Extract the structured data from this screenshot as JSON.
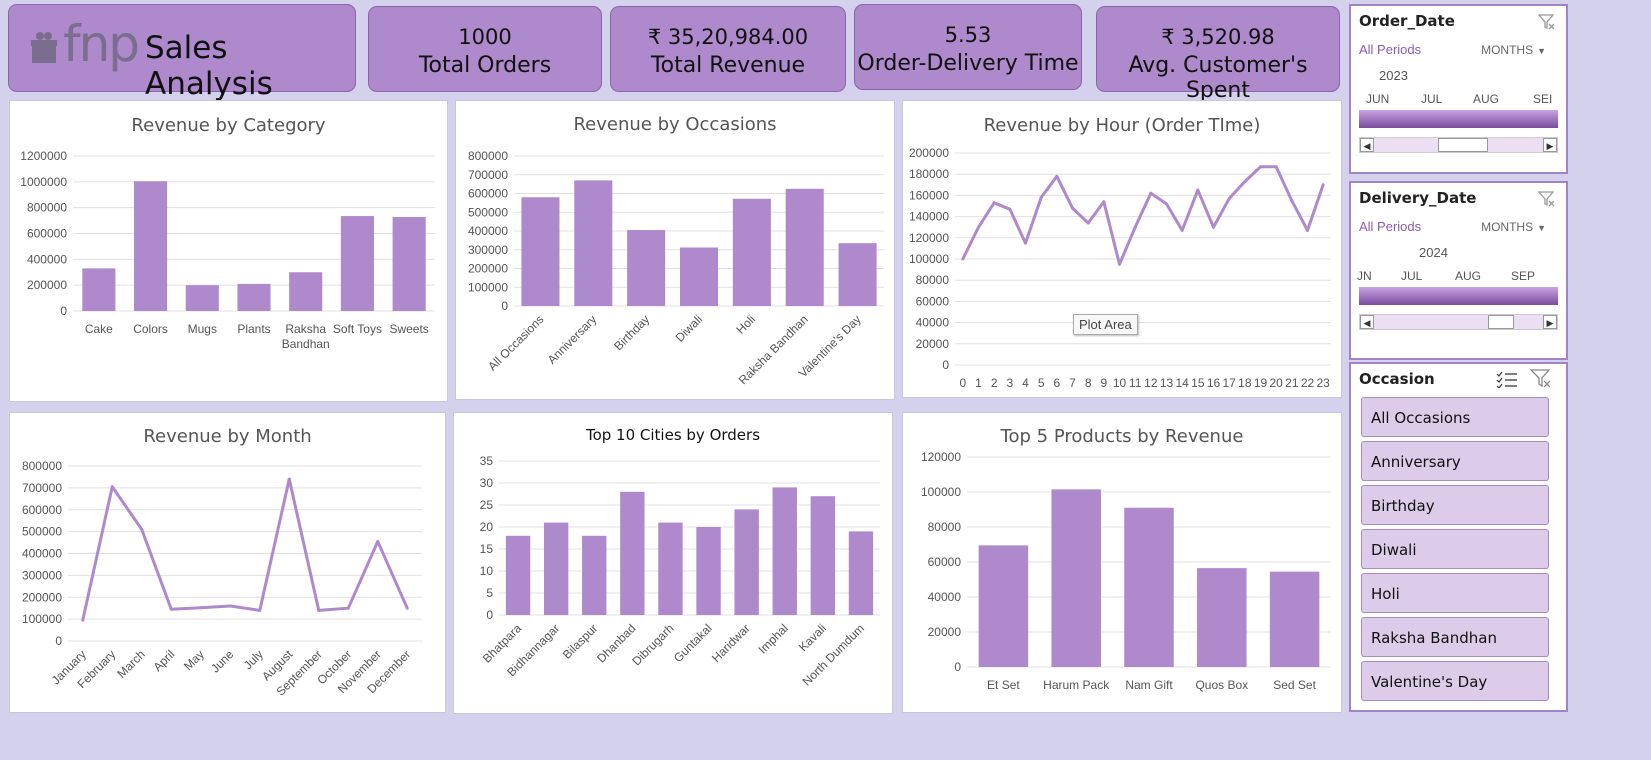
{
  "header": {
    "logo_text": "fnp",
    "title": "Sales Analysis"
  },
  "kpis": {
    "total_orders": {
      "value": "1000",
      "label": "Total Orders"
    },
    "total_revenue": {
      "value": "₹  35,20,984.00",
      "label": "Total Revenue"
    },
    "delivery_time": {
      "value": "5.53",
      "label": "Order-Delivery Time"
    },
    "avg_spent": {
      "value": "₹ 3,520.98",
      "label": "Avg. Customer's Spent"
    }
  },
  "slicers": {
    "order_date": {
      "title": "Order_Date",
      "period": "All Periods",
      "unit": "MONTHS",
      "year": "2023",
      "months": [
        "JUN",
        "JUL",
        "AUG",
        "SEI"
      ]
    },
    "delivery_date": {
      "title": "Delivery_Date",
      "period": "All Periods",
      "unit": "MONTHS",
      "year": "2024",
      "months": [
        "JN",
        "JUL",
        "AUG",
        "SEP"
      ]
    },
    "occasion": {
      "title": "Occasion",
      "items": [
        "All Occasions",
        "Anniversary",
        "Birthday",
        "Diwali",
        "Holi",
        "Raksha Bandhan",
        "Valentine's Day"
      ]
    }
  },
  "tooltip": "Plot Area",
  "colors": {
    "bar": "#ae89cb",
    "line": "#ae89cb",
    "kpi": "#ae89cb",
    "background": "#d3d1ec"
  },
  "chart_data": [
    {
      "id": "category",
      "type": "bar",
      "title": "Revenue by Category",
      "categories": [
        "Cake",
        "Colors",
        "Mugs",
        "Plants",
        "Raksha Bandhan",
        "Soft Toys",
        "Sweets"
      ],
      "values": [
        330000,
        1005000,
        200000,
        210000,
        300000,
        735000,
        728000
      ],
      "ylim": [
        0,
        1200000
      ],
      "yticks": [
        0,
        200000,
        400000,
        600000,
        800000,
        1000000,
        1200000
      ],
      "grid": true
    },
    {
      "id": "occasions",
      "type": "bar",
      "title": "Revenue by Occasions",
      "categories": [
        "All Occasions",
        "Anniversary",
        "Birthday",
        "Diwali",
        "Holi",
        "Raksha Bandhan",
        "Valentine's Day"
      ],
      "values": [
        580000,
        670000,
        405000,
        312000,
        572000,
        625000,
        335000
      ],
      "ylim": [
        0,
        800000
      ],
      "yticks": [
        0,
        100000,
        200000,
        300000,
        400000,
        500000,
        600000,
        700000,
        800000
      ],
      "grid": true
    },
    {
      "id": "hour",
      "type": "line",
      "title": "Revenue by Hour (Order TIme)",
      "categories": [
        "0",
        "1",
        "2",
        "3",
        "4",
        "5",
        "6",
        "7",
        "8",
        "9",
        "10",
        "11",
        "12",
        "13",
        "14",
        "15",
        "16",
        "17",
        "18",
        "19",
        "20",
        "21",
        "22",
        "23"
      ],
      "values": [
        100000,
        130000,
        153000,
        147000,
        115000,
        158000,
        178000,
        148000,
        134000,
        154000,
        95000,
        130000,
        162000,
        152000,
        127000,
        165000,
        130000,
        157000,
        173000,
        187000,
        187000,
        155000,
        127000,
        170000
      ],
      "ylim": [
        0,
        200000
      ],
      "yticks": [
        0,
        20000,
        40000,
        60000,
        80000,
        100000,
        120000,
        140000,
        160000,
        180000,
        200000
      ],
      "grid": true
    },
    {
      "id": "month",
      "type": "line",
      "title": "Revenue by Month",
      "categories": [
        "January",
        "February",
        "March",
        "April",
        "May",
        "June",
        "July",
        "August",
        "September",
        "October",
        "November",
        "December"
      ],
      "values": [
        95000,
        705000,
        510000,
        145000,
        152000,
        160000,
        140000,
        740000,
        140000,
        150000,
        455000,
        150000
      ],
      "ylim": [
        0,
        800000
      ],
      "yticks": [
        0,
        100000,
        200000,
        300000,
        400000,
        500000,
        600000,
        700000,
        800000
      ],
      "grid": true
    },
    {
      "id": "cities",
      "type": "bar",
      "title": "Top 10 Cities by Orders",
      "categories": [
        "Bhatpara",
        "Bidhannagar",
        "Bilaspur",
        "Dhanbad",
        "Dibrugarh",
        "Guntakal",
        "Haridwar",
        "Imphal",
        "Kavali",
        "North Dumdum"
      ],
      "values": [
        18,
        21,
        18,
        28,
        21,
        20,
        24,
        29,
        27,
        19
      ],
      "ylim": [
        0,
        35
      ],
      "yticks": [
        0,
        5,
        10,
        15,
        20,
        25,
        30,
        35
      ],
      "grid": true
    },
    {
      "id": "products",
      "type": "bar",
      "title": "Top 5 Products by Revenue",
      "categories": [
        "Et Set",
        "Harum Pack",
        "Nam Gift",
        "Quos Box",
        "Sed Set"
      ],
      "values": [
        69500,
        101500,
        91000,
        56500,
        54500
      ],
      "ylim": [
        0,
        120000
      ],
      "yticks": [
        0,
        20000,
        40000,
        60000,
        80000,
        100000,
        120000
      ],
      "grid": true
    }
  ]
}
